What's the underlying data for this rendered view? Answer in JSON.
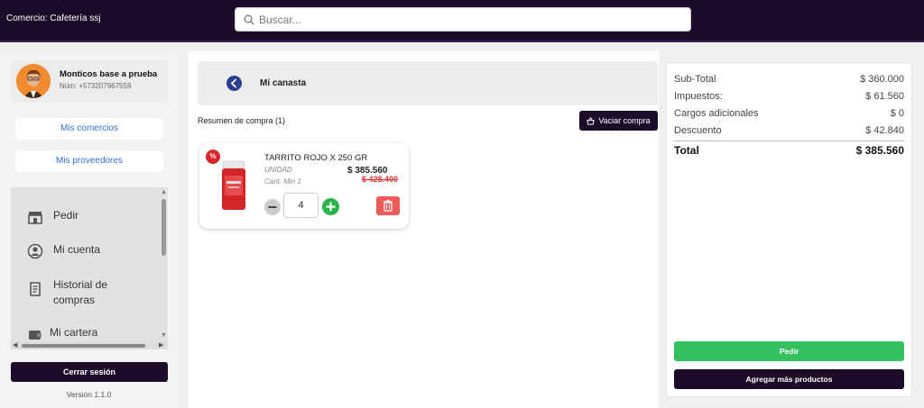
{
  "header": {
    "store_label": "Comercio: Cafetería ssj",
    "search_placeholder": "Buscar..."
  },
  "sidebar": {
    "profile_name": "Monticos base a prueba",
    "profile_phone": "Núm: +573207967559",
    "my_stores": "Mis comercios",
    "my_suppliers": "Mis proveedores",
    "menu": [
      {
        "label": "Pedir",
        "icon": "store-icon"
      },
      {
        "label": "Mi cuenta",
        "icon": "user-circle-icon"
      },
      {
        "label": "Historial de compras",
        "icon": "receipt-icon"
      },
      {
        "label": "Mi cartera",
        "icon": "wallet-icon"
      }
    ],
    "logout": "Cerrar sesión",
    "version": "Versión 1.1.0"
  },
  "cart": {
    "title": "Mi canasta",
    "summary": "Resumen de compra (1)",
    "empty_button": "Vaciar compra",
    "items": [
      {
        "name": "TARRITO ROJO X 250 GR",
        "unit": "UNIDAD",
        "min_qty": "Cant. Min 1",
        "price": "$ 385.560",
        "old_price": "$ 428.400",
        "quantity": "4",
        "promo_badge": "%"
      }
    ]
  },
  "totals": {
    "subtotal_label": "Sub-Total",
    "subtotal_value": "$ 360.000",
    "taxes_label": "Impuestos:",
    "taxes_value": "$ 61.560",
    "extra_label": "Cargos adicionales",
    "extra_value": "$ 0",
    "discount_label": "Descuento",
    "discount_value": "$ 42.840",
    "total_label": "Total",
    "total_value": "$ 385.560",
    "order_button": "Pedir",
    "more_button": "Agregar más productos"
  },
  "colors": {
    "brand_dark": "#1c0c2a",
    "accent_green": "#34c060",
    "link_blue": "#2f6fd3",
    "danger_red": "#f05a5a"
  }
}
